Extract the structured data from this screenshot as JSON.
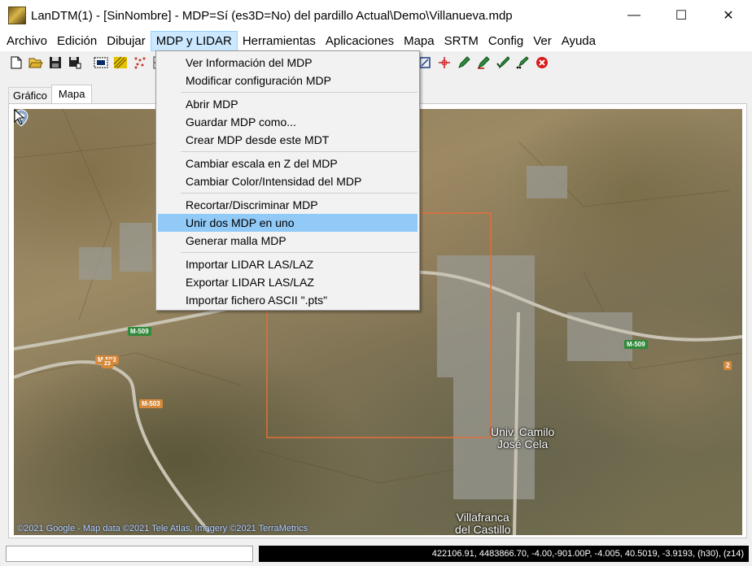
{
  "window": {
    "title": "LanDTM(1) - [SinNombre] - MDP=Sí (es3D=No)  del pardillo Actual\\Demo\\Villanueva.mdp",
    "minimize_glyph": "—",
    "maximize_glyph": "☐",
    "close_glyph": "✕"
  },
  "menubar": {
    "items": [
      "Archivo",
      "Edición",
      "Dibujar",
      "MDP y LIDAR",
      "Herramientas",
      "Aplicaciones",
      "Mapa",
      "SRTM",
      "Config",
      "Ver",
      "Ayuda"
    ],
    "active": "MDP y LIDAR"
  },
  "toolbar": {
    "icons": [
      "new-file-icon",
      "open-folder-icon",
      "save-icon",
      "save-as-icon",
      "frame-icon",
      "texture-icon",
      "points-icon",
      "grid-icon",
      "zoom-extent-icon",
      "target-icon",
      "pencil-icon",
      "pencil-edit-icon",
      "pencil-check-icon",
      "pencil-dots-icon",
      "stop-icon"
    ]
  },
  "tabs": [
    "Gráfico",
    "Mapa"
  ],
  "selected_tab": "Mapa",
  "dropdown": {
    "groups": [
      [
        "Ver Información del MDP",
        "Modificar configuración MDP"
      ],
      [
        "Abrir MDP",
        "Guardar MDP como...",
        "Crear MDP desde este MDT"
      ],
      [
        "Cambiar escala en Z del MDP",
        "Cambiar Color/Intensidad del MDP"
      ],
      [
        "Recortar/Discriminar MDP",
        "Unir dos MDP en uno",
        "Generar malla MDP"
      ],
      [
        "Importar LIDAR LAS/LAZ",
        "Exportar LIDAR LAS/LAZ",
        "Importar fichero ASCII \".pts\""
      ]
    ],
    "highlighted": "Unir dos MDP en uno"
  },
  "map": {
    "road_labels": {
      "m509_left": "M-509",
      "m503_top": "M-503",
      "m503_bottom": "M-503",
      "n23": "23",
      "m509_right": "M-509",
      "n2": "2"
    },
    "place_univ": "Univ. Camilo\nJosé Cela",
    "place_villafranca": "Villafranca\ndel Castillo",
    "copyright": "©2021 Google - Map data ©2021 Tele Atlas, Imagery ©2021 TerraMetrics",
    "selection_color": "#e0703a"
  },
  "statusbar": {
    "left": "",
    "coords": "422106.91, 4483866.70, -4.00,-901.00P, -4.005, 40.5019, -3.9193, (h30), (z14)"
  }
}
